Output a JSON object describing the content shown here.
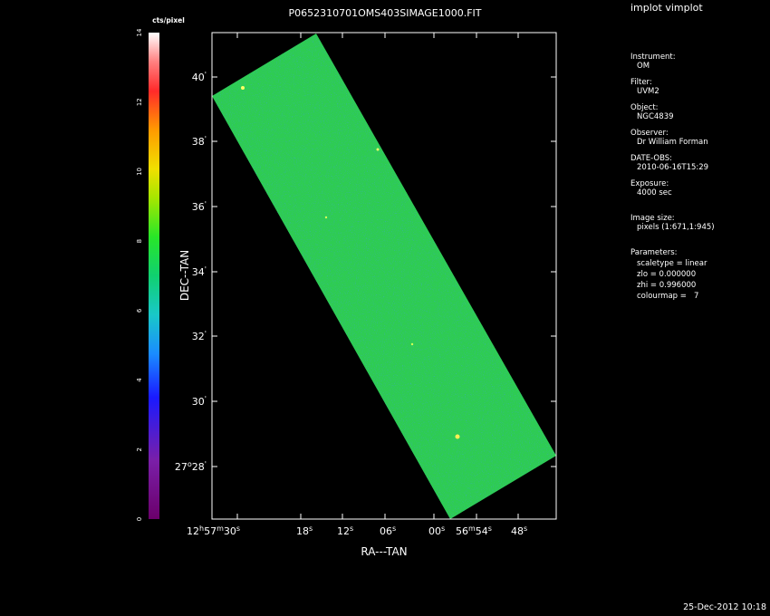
{
  "title": "P0652310701OMS403SIMAGE1000.FIT",
  "app_label": "implot vimplot",
  "footer_date": "25-Dec-2012 10:18",
  "colorbar": {
    "label": "cts/pixel",
    "ticks": [
      "0",
      "2",
      "4",
      "6",
      "8",
      "10",
      "12",
      "14"
    ],
    "max": 14
  },
  "axes": {
    "xlabel": "RA---TAN",
    "ylabel": "DEC--TAN",
    "x_ticks": [
      {
        "main": "12",
        "sup1": "h",
        "mid": "57",
        "sup2": "m",
        "last": "30",
        "sup3": "s"
      },
      {
        "main": "18",
        "sup1": "s"
      },
      {
        "main": "12",
        "sup1": "s"
      },
      {
        "main": "06",
        "sup1": "s"
      },
      {
        "main": "00",
        "sup1": "s"
      },
      {
        "main": "56",
        "sup1": "m",
        "mid": "54",
        "sup2": "s"
      },
      {
        "main": "48",
        "sup1": "s"
      }
    ],
    "y_ticks": [
      {
        "main": "40",
        "sup": "'"
      },
      {
        "main": "38",
        "sup": "'"
      },
      {
        "main": "36",
        "sup": "'"
      },
      {
        "main": "34",
        "sup": "'"
      },
      {
        "main": "32",
        "sup": "'"
      },
      {
        "main": "30",
        "sup": "'"
      },
      {
        "main": "27",
        "sup": "o",
        "main2": "28",
        "sup2": "'"
      }
    ]
  },
  "info": {
    "instrument_key": "Instrument:",
    "instrument": "OM",
    "filter_key": "Filter:",
    "filter": "UVM2",
    "object_key": "Object:",
    "object": "NGC4839",
    "observer_key": "Observer:",
    "observer": "Dr William Forman",
    "date_key": "DATE-OBS:",
    "date": "2010-06-16T15:29",
    "exposure_key": "Exposure:",
    "exposure": "4000 sec",
    "imagesize_key": "Image size:",
    "imagesize": "pixels (1:671,1:945)",
    "params_key": "Parameters:",
    "params": [
      "scaletype = linear",
      "zlo = 0.000000",
      "zhi = 0.996000",
      "colourmap =   7"
    ]
  },
  "colors": {
    "background": "#000000",
    "image_base": "#2ecc52",
    "frame": "#ffffff"
  }
}
